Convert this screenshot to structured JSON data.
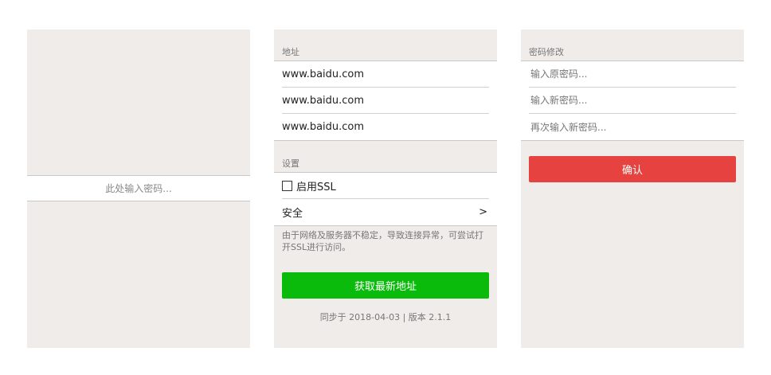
{
  "login_panel": {
    "password_placeholder": "此处输入密码..."
  },
  "address_panel": {
    "address_label": "地址",
    "addresses": [
      "www.baidu.com",
      "www.baidu.com",
      "www.baidu.com"
    ],
    "settings_label": "设置",
    "ssl_checkbox": {
      "label": "启用SSL",
      "checked": false
    },
    "security_item": {
      "label": "安全",
      "chevron": ">"
    },
    "hint": "由于网络及服务器不稳定，导致连接异常，可尝试打开SSL进行访问。",
    "fetch_button": "获取最新地址",
    "footer": "同步于 2018-04-03 | 版本 2.1.1",
    "accent": "#0bbb0b"
  },
  "password_panel": {
    "label": "密码修改",
    "old_placeholder": "输入原密码...",
    "new_placeholder": "输入新密码...",
    "repeat_placeholder": "再次输入新密码...",
    "confirm_button": "确认",
    "accent": "#e64340"
  }
}
